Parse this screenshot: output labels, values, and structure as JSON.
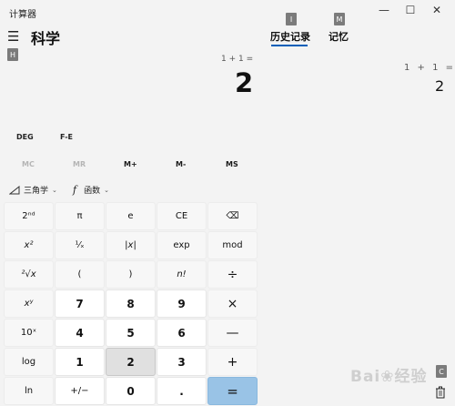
{
  "app": {
    "title": "计算器"
  },
  "window_controls": {
    "minimize": "—",
    "maximize": "☐",
    "close": "✕"
  },
  "header": {
    "mode": "科学"
  },
  "shortcut_badges": {
    "h": "H",
    "i": "I",
    "m": "M",
    "c": "C"
  },
  "tabs": {
    "history": "历史记录",
    "memory": "记忆"
  },
  "display": {
    "expression": "1 + 1 =",
    "value": "2"
  },
  "history": {
    "expression": "1 + 1 =",
    "result": "2"
  },
  "angle": {
    "deg": "DEG",
    "fe": "F-E"
  },
  "memory_row": [
    "MC",
    "MR",
    "M+",
    "M-",
    "MS"
  ],
  "menus": {
    "trig": "三角学",
    "func": "函数",
    "chev": "⌄",
    "func_glyph": "f"
  },
  "keys": {
    "r1": [
      "2ⁿᵈ",
      "π",
      "e",
      "CE",
      "⌫"
    ],
    "r2": [
      "x²",
      "¹⁄ₓ",
      "|x|",
      "exp",
      "mod"
    ],
    "r3": [
      "²√x",
      "(",
      ")",
      "n!",
      "÷"
    ],
    "r4": [
      "xʸ",
      "7",
      "8",
      "9",
      "×"
    ],
    "r5": [
      "10ˣ",
      "4",
      "5",
      "6",
      "—"
    ],
    "r6": [
      "log",
      "1",
      "2",
      "3",
      "+"
    ],
    "r7": [
      "ln",
      "+/−",
      "0",
      ".",
      "="
    ]
  },
  "watermark": "Bai❀经验"
}
